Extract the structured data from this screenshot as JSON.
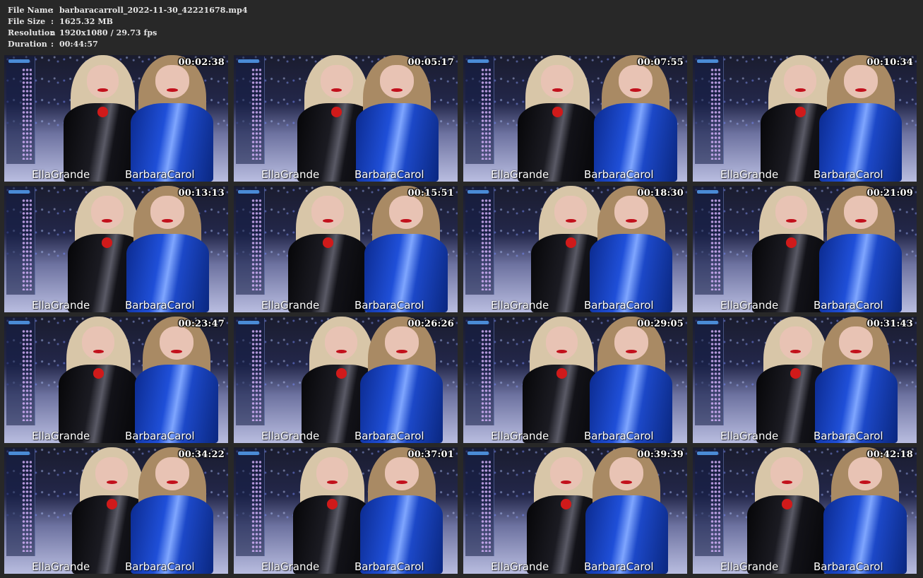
{
  "file_info": {
    "rows": [
      {
        "label": "File Name",
        "sep": ":",
        "value": "barbaracarroll_2022-11-30_42221678.mp4"
      },
      {
        "label": "File Size",
        "sep": ":",
        "value": "1625.32 MB"
      },
      {
        "label": "Resolution",
        "sep": ":",
        "value": "1920x1080 / 29.73 fps"
      },
      {
        "label": "Duration",
        "sep": ":",
        "value": "00:44:57"
      }
    ]
  },
  "thumbnails": [
    {
      "timestamp": "00:02:38",
      "left_name": "EllaGrande",
      "right_name": "BarbaraCarol"
    },
    {
      "timestamp": "00:05:17",
      "left_name": "EllaGrande",
      "right_name": "BarbaraCarol"
    },
    {
      "timestamp": "00:07:55",
      "left_name": "EllaGrande",
      "right_name": "BarbaraCarol"
    },
    {
      "timestamp": "00:10:34",
      "left_name": "EllaGrande",
      "right_name": "BarbaraCarol"
    },
    {
      "timestamp": "00:13:13",
      "left_name": "EllaGrande",
      "right_name": "BarbaraCarol"
    },
    {
      "timestamp": "00:15:51",
      "left_name": "EllaGrande",
      "right_name": "BarbaraCarol"
    },
    {
      "timestamp": "00:18:30",
      "left_name": "EllaGrande",
      "right_name": "BarbaraCarol"
    },
    {
      "timestamp": "00:21:09",
      "left_name": "EllaGrande",
      "right_name": "BarbaraCarol"
    },
    {
      "timestamp": "00:23:47",
      "left_name": "EllaGrande",
      "right_name": "BarbaraCarol"
    },
    {
      "timestamp": "00:26:26",
      "left_name": "EllaGrande",
      "right_name": "BarbaraCarol"
    },
    {
      "timestamp": "00:29:05",
      "left_name": "EllaGrande",
      "right_name": "BarbaraCarol"
    },
    {
      "timestamp": "00:31:43",
      "left_name": "EllaGrande",
      "right_name": "BarbaraCarol"
    },
    {
      "timestamp": "00:34:22",
      "left_name": "EllaGrande",
      "right_name": "BarbaraCarol"
    },
    {
      "timestamp": "00:37:01",
      "left_name": "EllaGrande",
      "right_name": "BarbaraCarol"
    },
    {
      "timestamp": "00:39:39",
      "left_name": "EllaGrande",
      "right_name": "BarbaraCarol"
    },
    {
      "timestamp": "00:42:18",
      "left_name": "EllaGrande",
      "right_name": "BarbaraCarol"
    }
  ],
  "colors": {
    "page_background": "#282828",
    "header_text": "#e6e6e6",
    "timestamp_text": "#ffffff",
    "latex_black": "#121218",
    "latex_blue": "#1f4fd8"
  }
}
